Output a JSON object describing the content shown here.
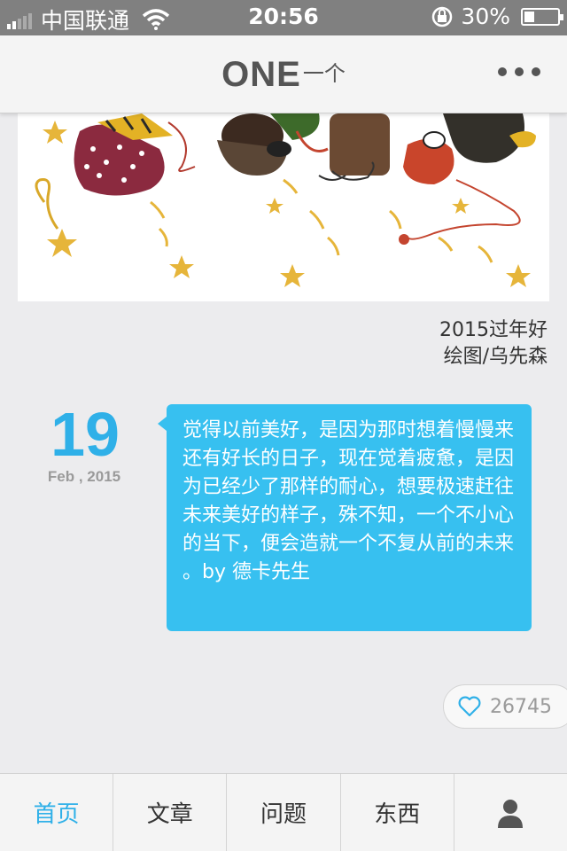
{
  "status_bar": {
    "carrier": "中国联通",
    "time": "20:56",
    "battery": "30%",
    "battery_level": 0.3
  },
  "header": {
    "logo_text": "ONE",
    "logo_sub": "一个"
  },
  "illustration": {
    "title": "2015过年好",
    "author": "绘图/乌先森"
  },
  "date": {
    "day": "19",
    "month_year": "Feb , 2015"
  },
  "quote": {
    "text": "觉得以前美好，是因为那时想着慢慢来还有好长的日子，现在觉着疲惫，是因为已经少了那样的耐心，想要极速赶往未来美好的样子，殊不知，一个不小心的当下，便会造就一个不复从前的未来 。by 德卡先生"
  },
  "like": {
    "count": "26745"
  },
  "tab_bar": {
    "items": [
      {
        "label": "首页",
        "active": true
      },
      {
        "label": "文章",
        "active": false
      },
      {
        "label": "问题",
        "active": false
      },
      {
        "label": "东西",
        "active": false
      }
    ]
  },
  "colors": {
    "accent": "#2fb0e8",
    "bubble": "#37c0f0",
    "status_bar": "#808080"
  }
}
